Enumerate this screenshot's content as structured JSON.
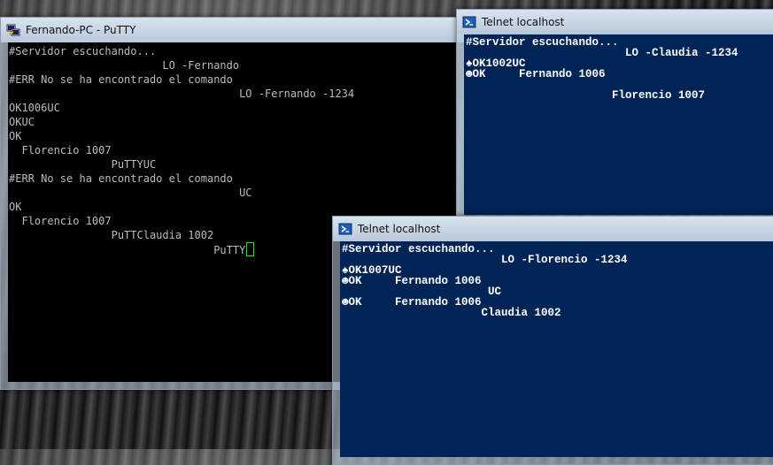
{
  "putty": {
    "title": "Fernando-PC - PuTTY",
    "icon": "putty-icon",
    "lines": [
      "#Servidor escuchando...",
      "                        LO -Fernando",
      "#ERR No se ha encontrado el comando",
      "                                    LO -Fernando -1234",
      "OK1006UC",
      "OKUC",
      "OK",
      "  Florencio 1007",
      "                PuTTYUC",
      "#ERR No se ha encontrado el comando",
      "                                    UC",
      "OK",
      "  Florencio 1007",
      "                PuTTClaudia 1002",
      "                                PuTTY"
    ]
  },
  "telnet_top": {
    "title": "Telnet localhost",
    "icon": "powershell-icon",
    "lines": [
      "#Servidor escuchando...",
      "                        LO -Claudia -1234",
      "♠OK1002UC",
      "☻OK     Fernando 1006",
      "",
      "                      Florencio 1007"
    ]
  },
  "telnet_bottom": {
    "title": "Telnet localhost",
    "icon": "powershell-icon",
    "lines": [
      "#Servidor escuchando...",
      "                        LO -Florencio -1234",
      "♠OK1007UC",
      "☻OK     Fernando 1006",
      "                      UC",
      "☻OK     Fernando 1006",
      "                     Claudia 1002"
    ]
  },
  "colors": {
    "putty_bg": "#000000",
    "putty_fg": "#bbbbbb",
    "telnet_bg": "#012456",
    "cursor": "#00ff00"
  }
}
